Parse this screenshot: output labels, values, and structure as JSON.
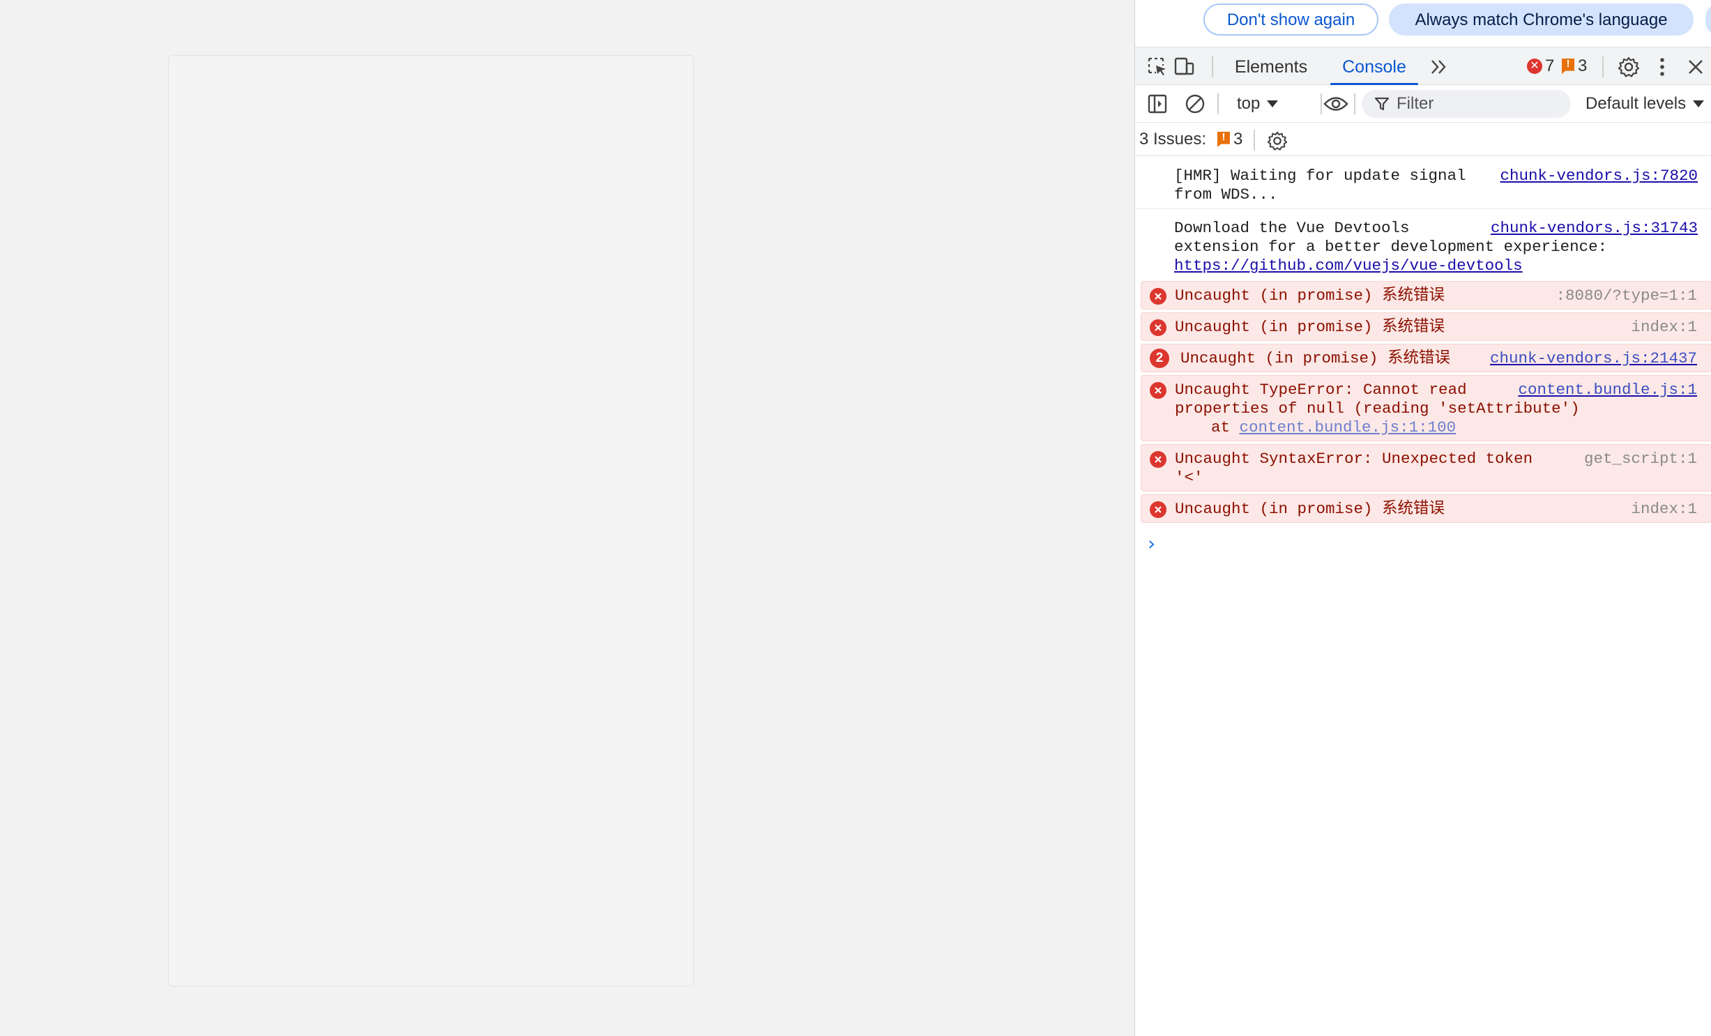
{
  "infobar": {
    "dont_show_label": "Don't show again",
    "always_match_label": "Always match Chrome's language"
  },
  "toolbar": {
    "tabs": [
      {
        "label": "Elements",
        "active": false
      },
      {
        "label": "Console",
        "active": true
      }
    ],
    "error_count": "7",
    "warning_count": "3",
    "accent_color": "#0b57d0"
  },
  "console_toolbar": {
    "context": "top",
    "filter_placeholder": "Filter",
    "levels": "Default levels"
  },
  "issues": {
    "label": "3 Issues:",
    "count": "3"
  },
  "messages": [
    {
      "type": "info",
      "text": "[HMR] Waiting for update signal from WDS...",
      "source": "chunk-vendors.js:7820"
    },
    {
      "type": "info",
      "text": "Download the Vue Devtools extension for a better development experience:",
      "link": "https://github.com/vuejs/vue-devtools",
      "source": "chunk-vendors.js:31743"
    },
    {
      "type": "error",
      "text": "Uncaught (in promise) 系统错误",
      "source": ":8080/?type=1:1"
    },
    {
      "type": "error",
      "text": "Uncaught (in promise) 系统错误",
      "source": "index:1"
    },
    {
      "type": "error",
      "repeat": "2",
      "text": "Uncaught (in promise) 系统错误",
      "source": "chunk-vendors.js:21437"
    },
    {
      "type": "error",
      "text": "Uncaught TypeError: Cannot read properties of null (reading 'setAttribute')",
      "stack_prefix": "at",
      "stack_link": "content.bundle.js:1:100",
      "source": "content.bundle.js:1"
    },
    {
      "type": "error",
      "text": "Uncaught SyntaxError: Unexpected token '<'",
      "source": "get_script:1"
    },
    {
      "type": "error",
      "text": "Uncaught (in promise) 系统错误",
      "source": "index:1"
    }
  ],
  "prompt_symbol": "›",
  "colors": {
    "error_bg": "#fce8e6",
    "error_text": "#8c0f00",
    "error_icon": "#dc362e",
    "warning_icon": "#e8710a",
    "link": "#1a0dab"
  }
}
